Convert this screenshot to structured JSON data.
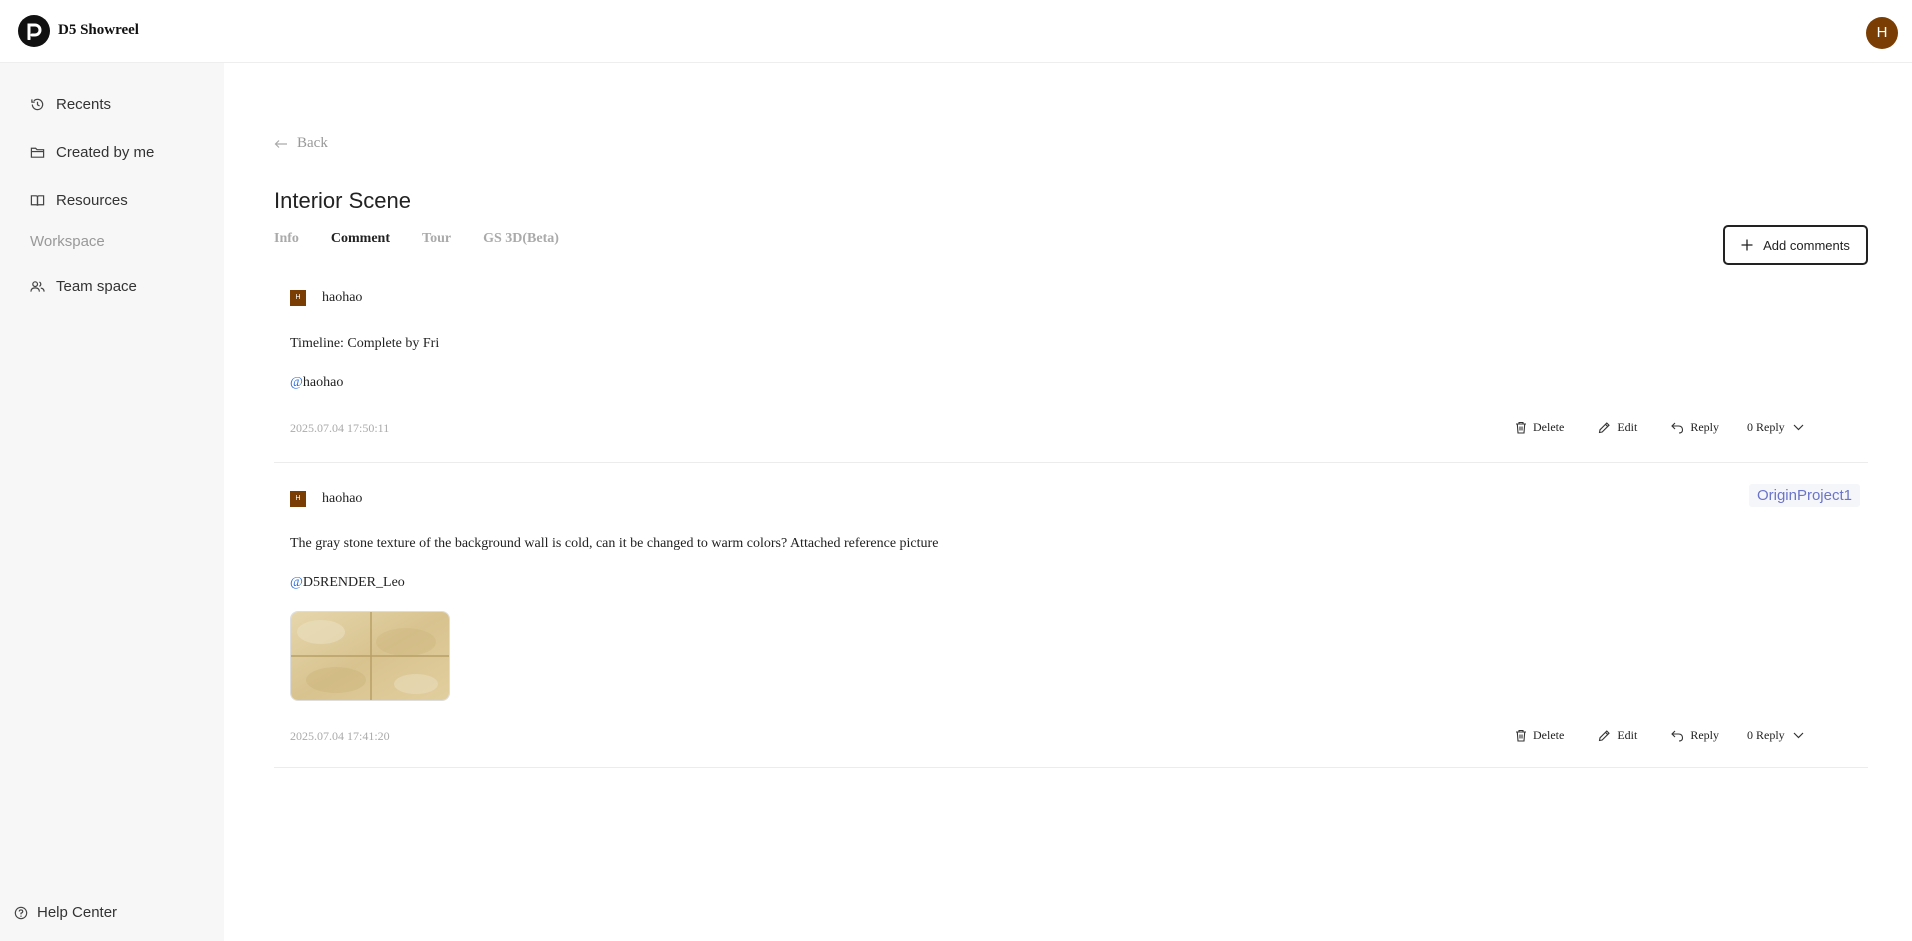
{
  "header": {
    "app_title": "D5 Showreel",
    "user_initial": "H"
  },
  "sidebar": {
    "items": [
      {
        "label": "Recents",
        "icon": "history-icon"
      },
      {
        "label": "Created by me",
        "icon": "folder-icon"
      },
      {
        "label": "Resources",
        "icon": "book-icon"
      }
    ],
    "section_label": "Workspace",
    "workspace_items": [
      {
        "label": "Team space",
        "icon": "team-icon"
      }
    ],
    "help_label": "Help Center"
  },
  "main": {
    "back_label": "Back",
    "title": "Interior Scene",
    "tabs": [
      {
        "label": "Info"
      },
      {
        "label": "Comment",
        "active": true
      },
      {
        "label": "Tour"
      },
      {
        "label": "GS 3D(Beta)"
      }
    ],
    "add_comments_label": "Add comments"
  },
  "comments": [
    {
      "avatar": "H",
      "user": "haohao",
      "text": "Timeline: Complete by Fri",
      "mention_at": "@",
      "mention_name": "haohao",
      "time": "2025.07.04 17:50:11",
      "actions": {
        "delete": "Delete",
        "edit": "Edit",
        "reply": "Reply",
        "reply_count": "0 Reply"
      }
    },
    {
      "avatar": "H",
      "user": "haohao",
      "badge": "OriginProject1",
      "text": "The gray stone texture of the background wall is cold, can it be changed to warm colors? Attached reference picture",
      "mention_at": "@",
      "mention_name": "D5RENDER_Leo",
      "time": "2025.07.04 17:41:20",
      "actions": {
        "delete": "Delete",
        "edit": "Edit",
        "reply": "Reply",
        "reply_count": "0 Reply"
      }
    }
  ],
  "colors": {
    "avatar": "#7a3e05",
    "mention": "#2f6fdc",
    "badge_text": "#6a74c9",
    "sidebar_bg": "#f7f7f7"
  }
}
